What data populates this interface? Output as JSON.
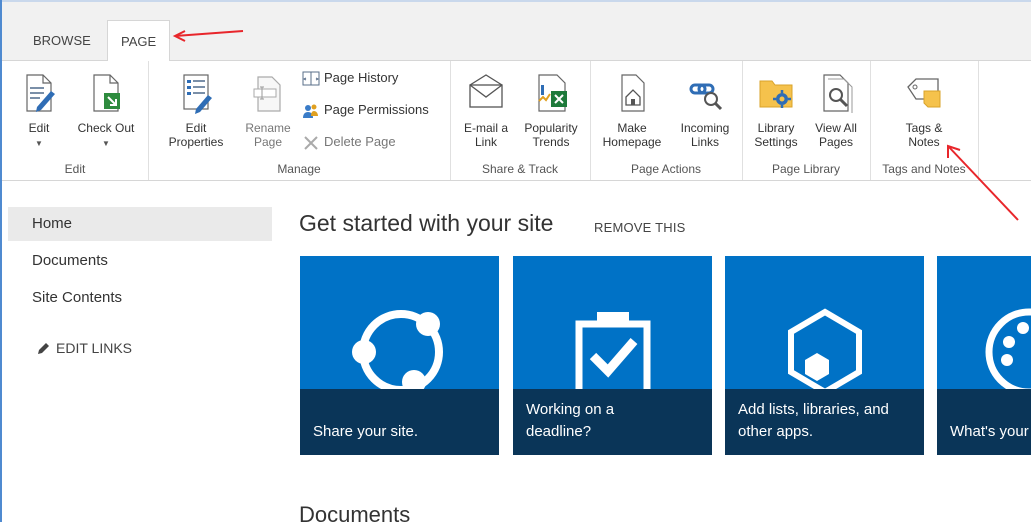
{
  "tabs": [
    {
      "label": "BROWSE"
    },
    {
      "label": "PAGE"
    }
  ],
  "ribbon": {
    "edit": {
      "group_label": "Edit",
      "edit_btn": "Edit",
      "checkout_btn": "Check Out"
    },
    "manage": {
      "group_label": "Manage",
      "edit_properties": "Edit\nProperties",
      "rename_page": "Rename\nPage",
      "page_history": "Page History",
      "page_permissions": "Page Permissions",
      "delete_page": "Delete Page"
    },
    "share_track": {
      "group_label": "Share & Track",
      "email_link": "E-mail a\nLink",
      "popularity_trends": "Popularity\nTrends"
    },
    "page_actions": {
      "group_label": "Page Actions",
      "make_homepage": "Make\nHomepage",
      "incoming_links": "Incoming\nLinks"
    },
    "page_library": {
      "group_label": "Page Library",
      "library_settings": "Library\nSettings",
      "view_all_pages": "View All\nPages"
    },
    "tags_notes": {
      "group_label": "Tags and Notes",
      "tags_notes_btn": "Tags &\nNotes"
    }
  },
  "nav": {
    "items": [
      {
        "label": "Home"
      },
      {
        "label": "Documents"
      },
      {
        "label": "Site Contents"
      }
    ],
    "edit_links": "EDIT LINKS"
  },
  "main": {
    "get_started_title": "Get started with your site",
    "remove_this": "REMOVE THIS",
    "tiles": [
      {
        "caption": "Share your site."
      },
      {
        "caption": "Working on a\ndeadline?"
      },
      {
        "caption": "Add lists, libraries, and\nother apps."
      },
      {
        "caption": "What's your"
      }
    ],
    "documents_heading": "Documents"
  },
  "colors": {
    "tile_blue": "#0072c6",
    "tile_band": "#0a3558",
    "annotation_red": "#e8262b"
  }
}
